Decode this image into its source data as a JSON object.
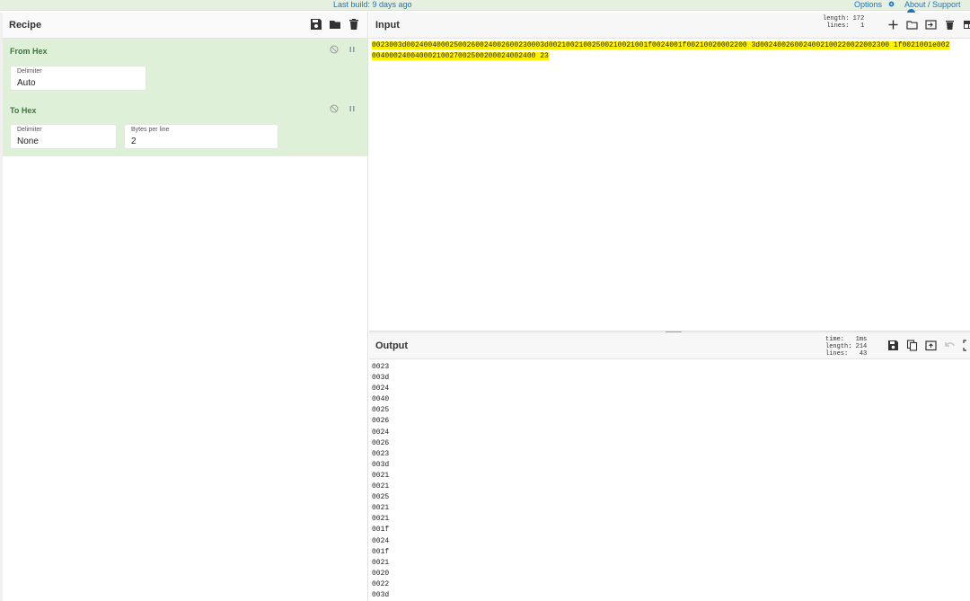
{
  "topbar": {
    "last_build": "Last build: 9 days ago",
    "options": "Options",
    "about": "About / Support"
  },
  "recipe": {
    "title": "Recipe",
    "icons": [
      "save-icon",
      "folder-icon",
      "trash-icon"
    ],
    "operations": [
      {
        "name": "From Hex",
        "fields": [
          {
            "label": "Delimiter",
            "value": "Auto"
          }
        ]
      },
      {
        "name": "To Hex",
        "fields": [
          {
            "label": "Delimiter",
            "value": "None"
          },
          {
            "label": "Bytes per line",
            "value": "2"
          }
        ]
      }
    ]
  },
  "input": {
    "title": "Input",
    "length_label": "length:",
    "length_value": "172",
    "lines_label": "lines:",
    "lines_value": "1",
    "icons": [
      "plus-icon",
      "open-folder-icon",
      "open-file-icon",
      "trash-icon",
      "layout-icon"
    ],
    "text_line1": "0023003d00240040002500260024002600230003d00210021002500210021001f0024001f00210020002200 3d002400260024002100220022002300 1f0021001e002",
    "text_line2": "00400024004000210027002500200024002400 23"
  },
  "output": {
    "title": "Output",
    "time_label": "time:",
    "time_value": "1ms",
    "length_label": "length:",
    "length_value": "214",
    "lines_label": "lines:",
    "lines_value": "43",
    "icons": [
      "save-icon",
      "copy-icon",
      "replace-input-icon",
      "undo-icon",
      "maximize-icon"
    ],
    "lines": [
      "0023",
      "003d",
      "0024",
      "0040",
      "0025",
      "0026",
      "0024",
      "0026",
      "0023",
      "003d",
      "0021",
      "0021",
      "0025",
      "0021",
      "0021",
      "001f",
      "0024",
      "001f",
      "0021",
      "0020",
      "0022",
      "003d"
    ]
  },
  "colors": {
    "op_background": "#dff0d8",
    "op_title": "#3c763d",
    "highlight": "#fff200",
    "link": "#1a73c7"
  }
}
